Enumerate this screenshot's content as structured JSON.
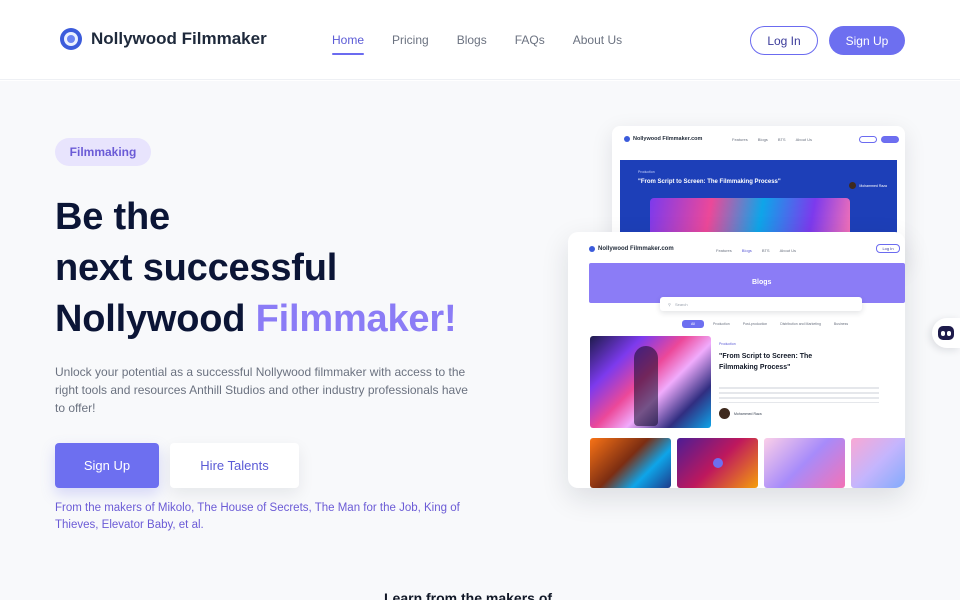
{
  "header": {
    "logo_text": "Nollywood Filmmaker",
    "nav": [
      "Home",
      "Pricing",
      "Blogs",
      "FAQs",
      "About Us"
    ],
    "active_nav": "Home",
    "login_label": "Log In",
    "signup_label": "Sign Up"
  },
  "hero": {
    "badge": "Filmmaking",
    "headline_line1": "Be the",
    "headline_line2": "next successful",
    "headline_line3_plain": "Nollywood ",
    "headline_line3_accent": "Filmmaker!",
    "description": "Unlock your potential as a successful Nollywood filmmaker with access to the right tools and resources Anthill Studios and other industry professionals have to offer!",
    "primary_cta": "Sign Up",
    "secondary_cta": "Hire Talents",
    "makers_text": "From the makers of Mikolo, The House of Secrets, The Man for the Job, King of Thieves, Elevator Baby, et al."
  },
  "mockup_back": {
    "logo_text": "Nollywood Filmmaker.com",
    "links": [
      "Features",
      "Blogs",
      "BTS",
      "About Us"
    ],
    "category": "Production",
    "title": "\"From Script to Screen: The Filmmaking Process\"",
    "author": "Mohammed Raza"
  },
  "mockup_front": {
    "logo_text": "Nollywood Filmmaker.com",
    "links": [
      "Features",
      "Blogs",
      "BTS",
      "About Us"
    ],
    "login": "Log In",
    "banner_title": "Blogs",
    "search_placeholder": "Search",
    "chips": [
      "All",
      "Production",
      "Post-production",
      "Distribution and Marketing",
      "Business"
    ],
    "feature_tag": "Production",
    "post_title": "\"From Script to Screen: The Filmmaking Process\"",
    "author": "Mohammed Raza"
  },
  "section": {
    "learn_title": "Learn from the makers of"
  },
  "colors": {
    "accent": "#6d6ff0",
    "headline": "#0b1536",
    "accent_text": "#8b7cf6"
  },
  "icons": {
    "logo": "camera-lens-icon",
    "chat": "chatbot-icon"
  }
}
